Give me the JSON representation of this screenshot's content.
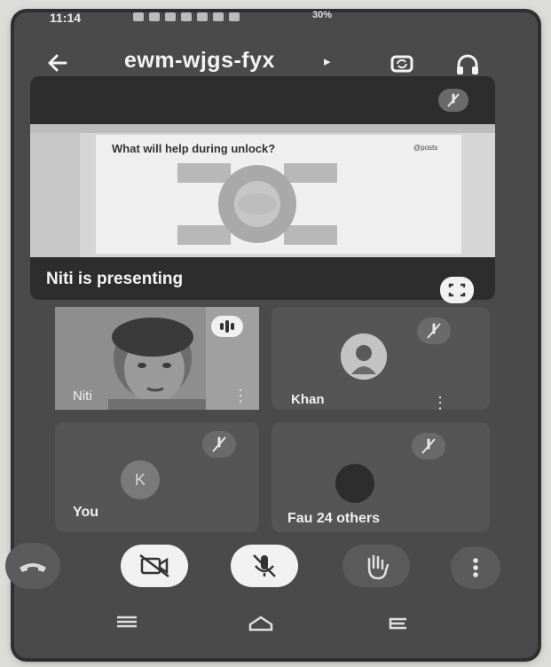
{
  "status_bar": {
    "time": "11:14",
    "battery": "30%"
  },
  "header": {
    "meeting_code": "ewm-wjgs-fyx",
    "code_arrow": "▸",
    "icons": [
      "back-arrow-icon",
      "switch-camera-icon",
      "headphones-icon"
    ]
  },
  "presentation": {
    "slide_title": "What will help during unlock?",
    "slide_logo": "@posts",
    "label": "Niti is presenting"
  },
  "participants": {
    "niti": {
      "name": "Niti"
    },
    "khan": {
      "name": "Khan"
    },
    "you": {
      "name": "You",
      "initial": "K"
    },
    "others": {
      "name": "Fau 24 others"
    }
  },
  "colors": {
    "background": "#4a4a4a",
    "button_light": "#f1f1f1",
    "button_dark": "#5b5b5b",
    "text": "#f0f0f0"
  }
}
